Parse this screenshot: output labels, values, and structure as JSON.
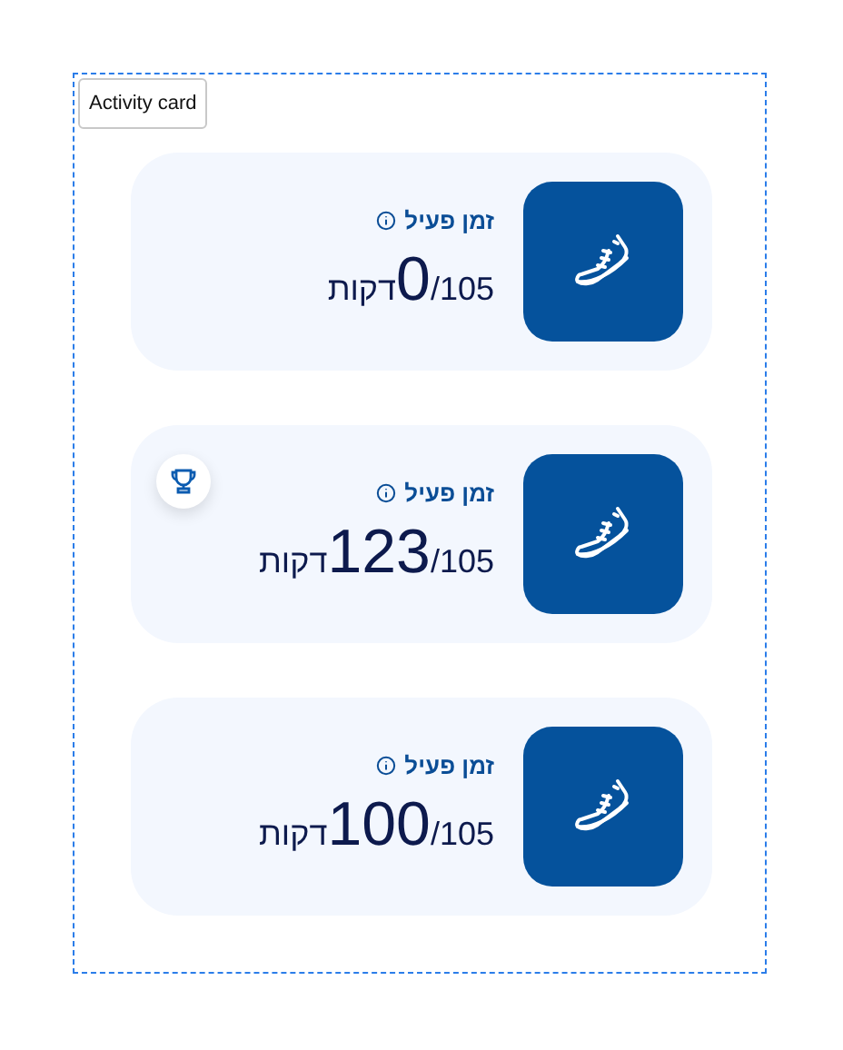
{
  "label": "Activity card",
  "cards": [
    {
      "title": "זמן פעיל",
      "value": "0",
      "goal": "/105",
      "unit": "דקות",
      "achieved": false
    },
    {
      "title": "זמן פעיל",
      "value": "123",
      "goal": "/105",
      "unit": "דקות",
      "achieved": true
    },
    {
      "title": "זמן פעיל",
      "value": "100",
      "goal": "/105",
      "unit": "דקות",
      "achieved": false
    }
  ]
}
